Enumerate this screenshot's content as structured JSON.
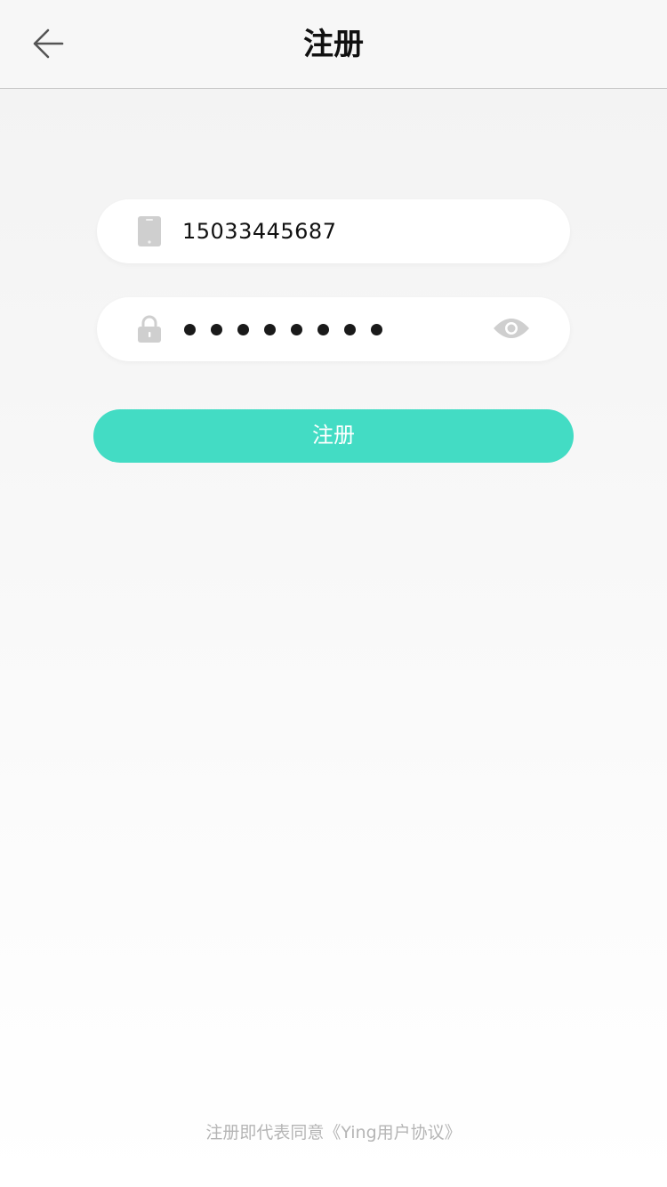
{
  "header": {
    "title": "注册",
    "back_icon": "back-arrow-icon"
  },
  "form": {
    "phone": {
      "icon": "phone-icon",
      "value": "15033445687"
    },
    "password": {
      "icon": "lock-icon",
      "masked_length": 8,
      "toggle_icon": "eye-icon"
    },
    "submit_label": "注册"
  },
  "footer": {
    "agreement_text": "注册即代表同意《Ying用户协议》"
  },
  "colors": {
    "accent": "#43dcc4",
    "icon_gray": "#cfcfcf",
    "text_dark": "#111111",
    "hint_gray": "#b5b5b5"
  }
}
